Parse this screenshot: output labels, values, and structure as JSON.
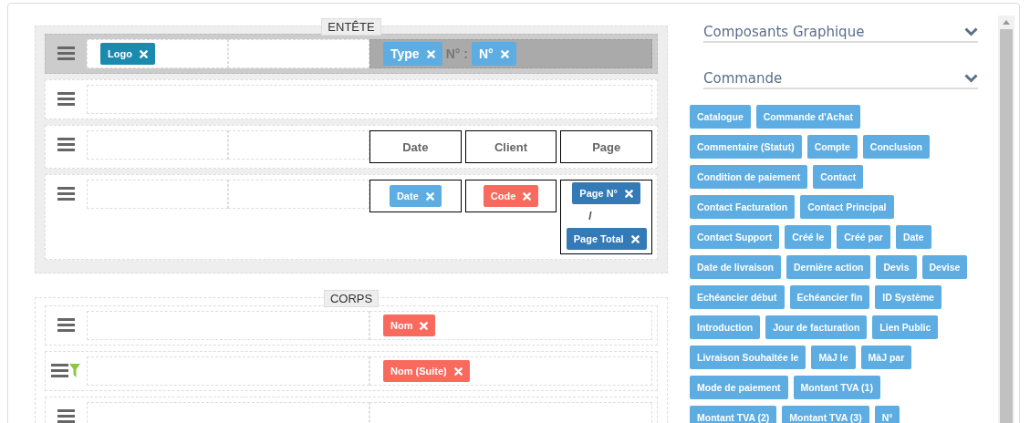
{
  "header_section": {
    "title": "ENTÊTE",
    "rows": [
      {
        "selected": true,
        "filter": false,
        "cells": [
          {
            "selected": false,
            "items": [
              {
                "kind": "tag",
                "label": "Logo",
                "color": "#1a8aae"
              }
            ]
          },
          {
            "selected": false
          },
          {
            "selected": true,
            "items": [
              {
                "kind": "tag",
                "label": "Type",
                "color": "#5dade2"
              },
              {
                "kind": "text",
                "text": "N° :"
              },
              {
                "kind": "tag",
                "label": "N°",
                "color": "#5dade2"
              }
            ]
          }
        ]
      },
      {
        "selected": false,
        "filter": false,
        "cells": [
          {
            "selected": false
          }
        ]
      },
      {
        "selected": false,
        "filter": false,
        "cells": [
          {
            "selected": false
          },
          {
            "selected": false
          },
          {
            "table": [
              {
                "items": [
                  {
                    "kind": "heading",
                    "text": "Date"
                  }
                ]
              },
              {
                "items": [
                  {
                    "kind": "heading",
                    "text": "Client"
                  }
                ]
              },
              {
                "items": [
                  {
                    "kind": "heading",
                    "text": "Page"
                  }
                ]
              }
            ]
          }
        ]
      },
      {
        "selected": false,
        "filter": false,
        "cells": [
          {
            "selected": false
          },
          {
            "selected": false
          },
          {
            "table": [
              {
                "items": [
                  {
                    "kind": "tag",
                    "label": "Date",
                    "color": "#5dade2"
                  }
                ]
              },
              {
                "items": [
                  {
                    "kind": "tag",
                    "label": "Code",
                    "color": "#f96a5e"
                  }
                ]
              },
              {
                "items": [
                  {
                    "kind": "tag",
                    "label": "Page N°",
                    "color": "#337ab7"
                  },
                  {
                    "kind": "slash",
                    "text": "/"
                  },
                  {
                    "kind": "tag",
                    "label": "Page Total",
                    "color": "#337ab7"
                  }
                ]
              }
            ]
          }
        ]
      }
    ]
  },
  "body_section": {
    "title": "CORPS",
    "rows": [
      {
        "selected": false,
        "filter": false,
        "cells": [
          {
            "selected": false
          },
          {
            "selected": false,
            "items": [
              {
                "kind": "tag",
                "label": "Nom",
                "color": "#f96a5e"
              }
            ]
          }
        ]
      },
      {
        "selected": false,
        "filter": true,
        "cells": [
          {
            "selected": false
          },
          {
            "selected": false,
            "items": [
              {
                "kind": "tag",
                "label": "Nom (Suite)",
                "color": "#f96a5e"
              }
            ]
          }
        ]
      },
      {
        "selected": false,
        "filter": false,
        "cells": [
          {
            "selected": false
          },
          {
            "selected": false
          }
        ]
      }
    ]
  },
  "sidebar": {
    "accordions": [
      {
        "title": "Composants Graphique"
      },
      {
        "title": "Commande",
        "field_rows": [
          [
            "Catalogue",
            "Commande d'Achat"
          ],
          [
            "Commentaire (Statut)",
            "Compte",
            "Conclusion"
          ],
          [
            "Condition de paiement",
            "Contact"
          ],
          [
            "Contact Facturation",
            "Contact Principal"
          ],
          [
            "Contact Support",
            "Créé le",
            "Créé par",
            "Date"
          ],
          [
            "Date de livraison",
            "Dernière action",
            "Devis",
            "Devise"
          ],
          [
            "Echéancier début",
            "Echéancier fin",
            "ID Système"
          ],
          [
            "Introduction",
            "Jour de facturation",
            "Lien Public"
          ],
          [
            "Livraison Souhaitée le",
            "MàJ le",
            "MàJ par"
          ],
          [
            "Mode de paiement",
            "Montant TVA (1)"
          ],
          [
            "Montant TVA (2)",
            "Montant TVA (3)",
            "N°"
          ]
        ]
      }
    ]
  }
}
